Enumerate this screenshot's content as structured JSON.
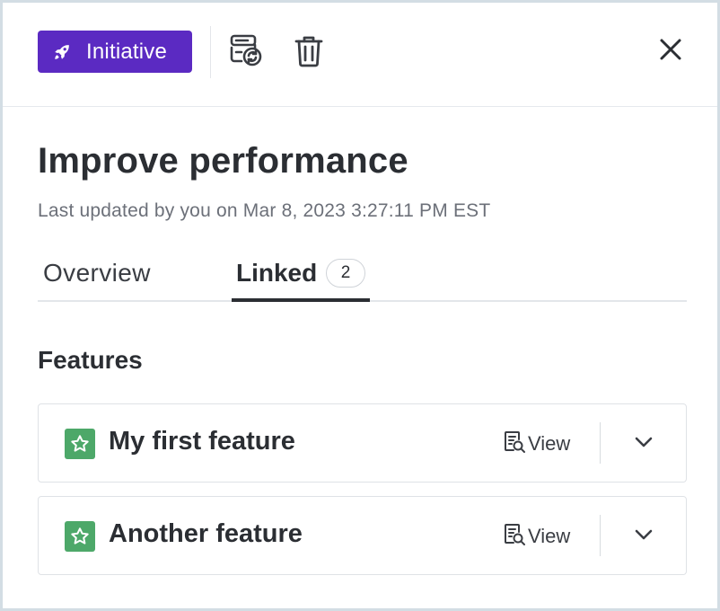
{
  "header": {
    "type_badge": {
      "label": "Initiative",
      "icon": "rocket-icon",
      "color": "#5b2ac2"
    },
    "actions": [
      {
        "name": "convert",
        "icon": "convert-record-icon"
      },
      {
        "name": "delete",
        "icon": "trash-icon"
      },
      {
        "name": "close",
        "icon": "close-icon"
      }
    ]
  },
  "record": {
    "title": "Improve performance",
    "updated": "Last updated by you on Mar 8, 2023 3:27:11 PM EST"
  },
  "tabs": [
    {
      "label": "Overview",
      "active": false
    },
    {
      "label": "Linked",
      "active": true,
      "count": "2"
    }
  ],
  "linked": {
    "section_title": "Features",
    "items": [
      {
        "name": "My first feature",
        "icon": "star-icon",
        "icon_color": "#4da869",
        "view_label": "View"
      },
      {
        "name": "Another feature",
        "icon": "star-icon",
        "icon_color": "#4da869",
        "view_label": "View"
      }
    ]
  }
}
